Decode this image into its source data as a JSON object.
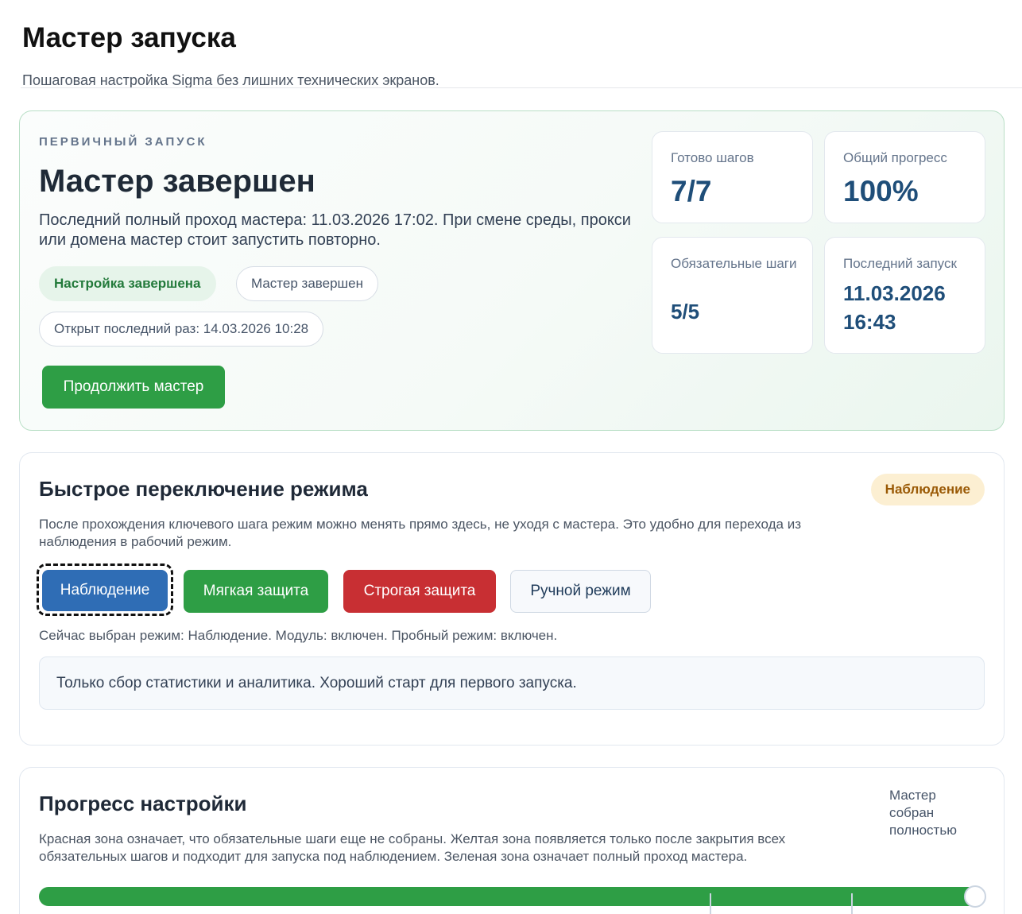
{
  "header": {
    "title": "Мастер запуска",
    "subtitle": "Пошаговая настройка Sigma без лишних технических экранов."
  },
  "hero": {
    "eyebrow": "ПЕРВИЧНЫЙ ЗАПУСК",
    "title": "Мастер завершен",
    "description": "Последний полный проход мастера: 11.03.2026 17:02. При смене среды, прокси или домена мастер стоит запустить повторно.",
    "chips": {
      "setup_done": "Настройка завершена",
      "wizard_done": "Мастер завершен",
      "last_opened": "Открыт последний раз: 14.03.2026 10:28"
    },
    "continue_button": "Продолжить мастер",
    "stats": {
      "steps_ready": {
        "label": "Готово шагов",
        "value": "7/7"
      },
      "total_progress": {
        "label": "Общий прогресс",
        "value": "100%"
      },
      "required_steps": {
        "label": "Обязательные шаги",
        "value": "5/5"
      },
      "last_run": {
        "label": "Последний запуск",
        "value": "11.03.2026 16:43"
      }
    }
  },
  "mode_switch": {
    "title": "Быстрое переключение режима",
    "badge": "Наблюдение",
    "description": "После прохождения ключевого шага режим можно менять прямо здесь, не уходя с мастера. Это удобно для перехода из наблюдения в рабочий режим.",
    "buttons": {
      "observe": "Наблюдение",
      "soft": "Мягкая защита",
      "strict": "Строгая защита",
      "manual": "Ручной режим"
    },
    "status": "Сейчас выбран режим: Наблюдение. Модуль: включен. Пробный режим: включен.",
    "info": "Только сбор статистики и аналитика. Хороший старт для первого запуска."
  },
  "progress": {
    "title": "Прогресс настройки",
    "note": "Мастер собран полностью",
    "description": "Красная зона означает, что обязательные шаги еще не собраны. Желтая зона появляется только после закрытия всех обязательных шагов и подходит для запуска под наблюдением. Зеленая зона означает полный проход мастера.",
    "value_percent": 100,
    "fill_color": "#2e9e45"
  }
}
